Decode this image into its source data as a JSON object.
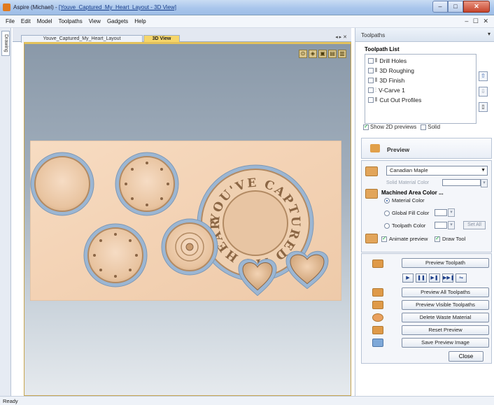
{
  "window": {
    "title_prefix": "Aspire (Michael) - ",
    "title_path": "[Youve_Captured_My_Heart_Layout - 3D View]",
    "min": "–",
    "max": "□",
    "close": "✕"
  },
  "menu": {
    "items": [
      "File",
      "Edit",
      "Model",
      "Toolpaths",
      "View",
      "Gadgets",
      "Help"
    ],
    "controls": "– ☐ ✕"
  },
  "left_strip": {
    "tab": "Drawing"
  },
  "doc_tabs": {
    "tab1": "Youve_Captured_My_Heart_Layout",
    "tab2": "3D View",
    "nav": "◂ ▸ ✕"
  },
  "view_tools": [
    "⊙",
    "◈",
    "▣",
    "▤",
    "▥"
  ],
  "board": {
    "ring_text": "YOU'VE CAPTURED MY HEART"
  },
  "panel": {
    "title": "Toolpaths",
    "pin": "▾",
    "list_title": "Toolpath List",
    "toolpaths": [
      {
        "name": "Drill Holes",
        "glyph": "⫴"
      },
      {
        "name": "3D Roughing",
        "glyph": "⫴"
      },
      {
        "name": "3D Finish",
        "glyph": "⫴"
      },
      {
        "name": "V-Carve 1",
        "glyph": "⫶"
      },
      {
        "name": "Cut Out Profiles",
        "glyph": "⫴"
      }
    ],
    "side_buttons": [
      "⇧",
      "⇩",
      "▯"
    ],
    "show_2d_previews": "Show 2D previews",
    "solid": "Solid",
    "preview_title": "Preview",
    "material": "Canadian Maple",
    "solid_material_color": "Solid Material Color",
    "machined_area_color": "Machined Area Color ...",
    "material_color": "Material Color",
    "global_fill_color": "Global Fill Color",
    "toolpath_color": "Toolpath Color",
    "set_all": "Set All",
    "animate_preview": "Animate preview",
    "draw_tool": "Draw Tool",
    "preview_toolpath": "Preview Toolpath",
    "play_controls": [
      "▶",
      "❚❚",
      "▶❚",
      "▶▶❚",
      "⇋"
    ],
    "preview_all": "Preview All Toolpaths",
    "preview_visible": "Preview Visible Toolpaths",
    "delete_waste": "Delete Waste Material",
    "reset_preview": "Reset Preview",
    "save_preview": "Save Preview Image",
    "close": "Close"
  },
  "status": "Ready"
}
